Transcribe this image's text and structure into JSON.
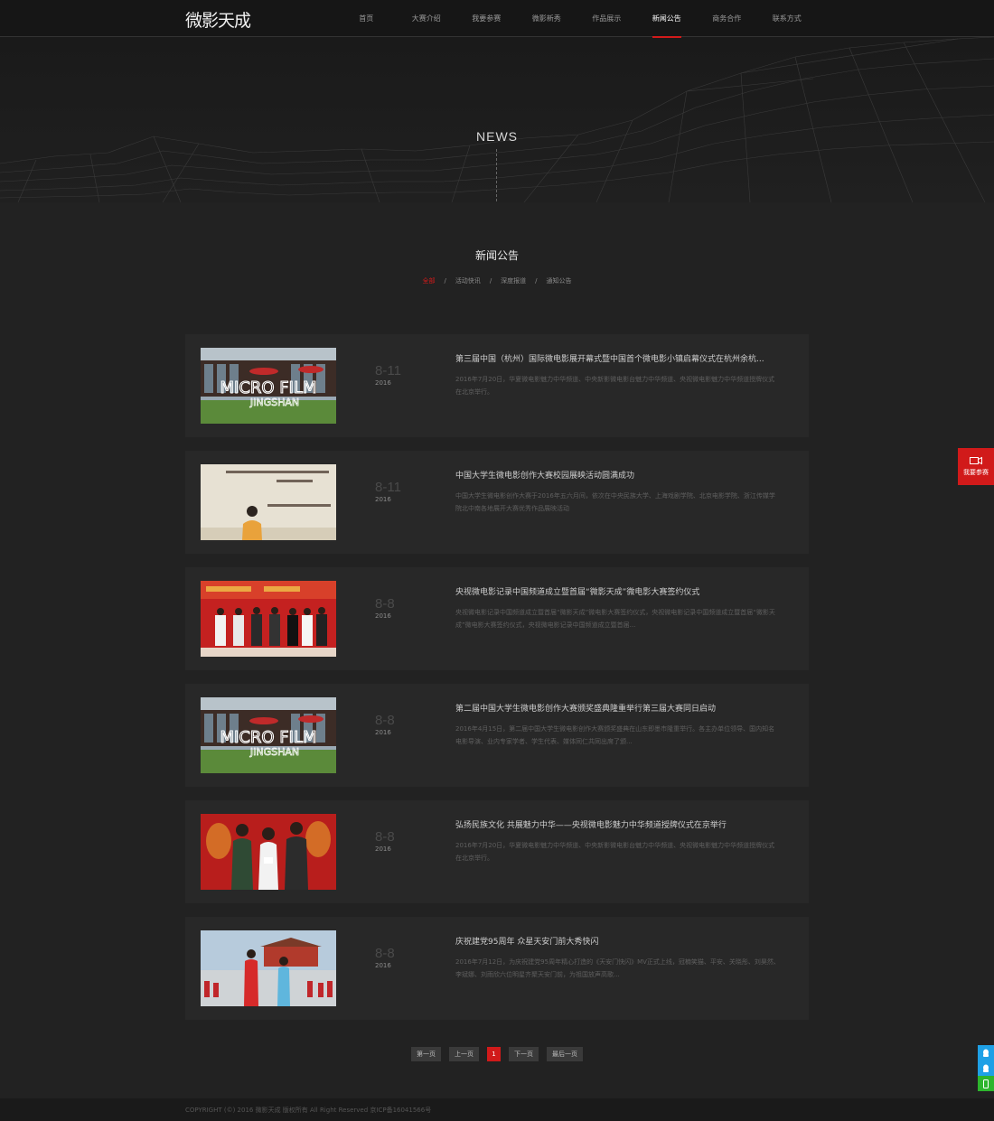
{
  "header": {
    "logo": "微影天成",
    "nav": [
      {
        "label": "首页",
        "active": false
      },
      {
        "label": "大赛介绍",
        "active": false
      },
      {
        "label": "我要参赛",
        "active": false
      },
      {
        "label": "微影新秀",
        "active": false
      },
      {
        "label": "作品展示",
        "active": false
      },
      {
        "label": "新闻公告",
        "active": true
      },
      {
        "label": "商务合作",
        "active": false
      },
      {
        "label": "联系方式",
        "active": false
      }
    ]
  },
  "banner": {
    "title": "NEWS"
  },
  "section": {
    "title": "新闻公告",
    "filters": [
      "全部",
      "活动快讯",
      "深度报道",
      "通知公告"
    ],
    "active_filter": "全部"
  },
  "news": [
    {
      "thumb": "micro-film-jingshan",
      "md": "8-11",
      "year": "2016",
      "title": "第三届中国（杭州）国际微电影展开幕式暨中国首个微电影小镇启幕仪式在杭州余杭...",
      "desc": "2016年7月20日，华夏微电影魅力中华频道、中央新影微电影台魅力中华频道、央视微电影魅力中华频道授牌仪式在北京举行。"
    },
    {
      "thumb": "university-screening",
      "md": "8-11",
      "year": "2016",
      "title": "中国大学生微电影创作大赛校园展映活动圆满成功",
      "desc": "中国大学生微电影创作大赛于2016年五六月间，依次在中央民族大学、上海戏剧学院、北京电影学院、浙江传媒学院北中南各地展开大赛优秀作品展映活动"
    },
    {
      "thumb": "signing-ceremony",
      "md": "8-8",
      "year": "2016",
      "title": "央视微电影记录中国频道成立暨首届“微影天成”微电影大赛签约仪式",
      "desc": "央视微电影记录中国频道成立暨首届“微影天成”微电影大赛签约仪式，央视微电影记录中国频道成立暨首届“微影天成”微电影大赛签约仪式，央视微电影记录中国频道成立暨首届..."
    },
    {
      "thumb": "micro-film-jingshan",
      "md": "8-8",
      "year": "2016",
      "title": "第二届中国大学生微电影创作大赛颁奖盛典隆重举行第三届大赛同日启动",
      "desc": "2016年4月15日，第二届中国大学生微电影创作大赛颁奖盛典在山东即墨市隆重举行。各主办单位领导、国内知名电影导演、业内专家学者、学生代表、媒体同仁共同出席了颁..."
    },
    {
      "thumb": "award-ceremony",
      "md": "8-8",
      "year": "2016",
      "title": "弘扬民族文化 共展魅力中华——央视微电影魅力中华频道授牌仪式在京举行",
      "desc": "2016年7月20日，华夏微电影魅力中华频道、中央新影微电影台魅力中华频道、央视微电影魅力中华频道授牌仪式在北京举行。"
    },
    {
      "thumb": "tiananmen-show",
      "md": "8-8",
      "year": "2016",
      "title": "庆祝建党95周年 众星天安门前大秀快闪",
      "desc": "2016年7月12日，为庆祝建党95周年精心打造的《天安门快闪》MV正式上线，冠楠笑猫、平安、关晓彤、刘昊然、李斌娜、刘雨欣六位明星齐聚天安门前，为祖国放声高歌..."
    }
  ],
  "pagination": {
    "first": "第一页",
    "prev": "上一页",
    "current": "1",
    "next": "下一页",
    "last": "最后一页"
  },
  "footer": {
    "copyright": "COPYRIGHT (©) 2016 微影天成 版权所有 All Right Reserved 京ICP备16041566号"
  },
  "side": {
    "join_label": "我要参赛"
  },
  "colors": {
    "accent": "#d11a1a",
    "background": "#222222",
    "card": "#282828"
  }
}
